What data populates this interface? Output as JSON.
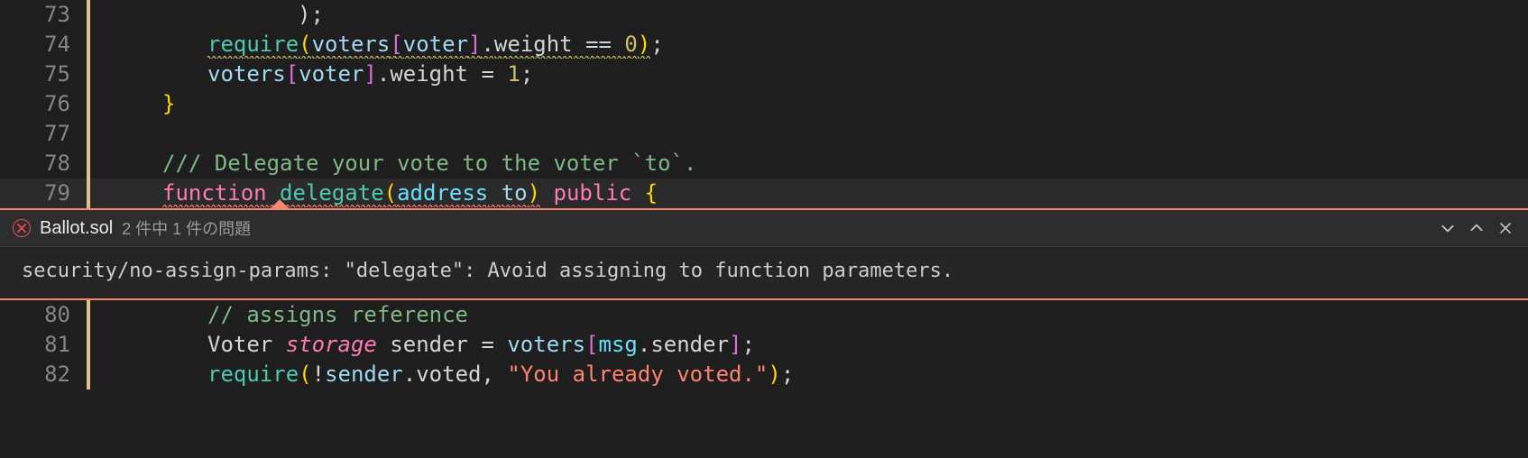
{
  "editor": {
    "lines": [
      {
        "num": "73",
        "indent": 4,
        "tokens": [
          {
            "t": ");",
            "c": "tok-op"
          }
        ]
      },
      {
        "num": "74",
        "indent": 2,
        "tokens": [
          {
            "t": "require",
            "c": "tok-func squiggle-warn"
          },
          {
            "t": "(",
            "c": "tok-paren squiggle-warn"
          },
          {
            "t": "voters",
            "c": "tok-ident squiggle-warn"
          },
          {
            "t": "[",
            "c": "tok-bracket squiggle-warn"
          },
          {
            "t": "voter",
            "c": "tok-ident squiggle-warn"
          },
          {
            "t": "]",
            "c": "tok-bracket squiggle-warn"
          },
          {
            "t": ".",
            "c": "tok-op squiggle-warn"
          },
          {
            "t": "weight",
            "c": "tok-prop squiggle-warn"
          },
          {
            "t": " == ",
            "c": "tok-op squiggle-warn"
          },
          {
            "t": "0",
            "c": "tok-num squiggle-warn"
          },
          {
            "t": ")",
            "c": "tok-paren squiggle-warn"
          },
          {
            "t": ";",
            "c": "tok-op"
          }
        ]
      },
      {
        "num": "75",
        "indent": 2,
        "tokens": [
          {
            "t": "voters",
            "c": "tok-ident"
          },
          {
            "t": "[",
            "c": "tok-bracket"
          },
          {
            "t": "voter",
            "c": "tok-ident"
          },
          {
            "t": "]",
            "c": "tok-bracket"
          },
          {
            "t": ".",
            "c": "tok-op"
          },
          {
            "t": "weight",
            "c": "tok-prop"
          },
          {
            "t": " = ",
            "c": "tok-op"
          },
          {
            "t": "1",
            "c": "tok-num"
          },
          {
            "t": ";",
            "c": "tok-op"
          }
        ]
      },
      {
        "num": "76",
        "indent": 1,
        "tokens": [
          {
            "t": "}",
            "c": "tok-brace"
          }
        ]
      },
      {
        "num": "77",
        "indent": 0,
        "tokens": []
      },
      {
        "num": "78",
        "indent": 1,
        "tokens": [
          {
            "t": "/// Delegate your vote to the voter `to`.",
            "c": "tok-doccomment"
          }
        ]
      },
      {
        "num": "79",
        "indent": 1,
        "active": true,
        "tokens": [
          {
            "t": "function",
            "c": "tok-keyword squiggle-err"
          },
          {
            "t": " ",
            "c": "squiggle-err"
          },
          {
            "t": "delegate",
            "c": "tok-func squiggle-err"
          },
          {
            "t": "(",
            "c": "tok-paren squiggle-err"
          },
          {
            "t": "address",
            "c": "tok-type squiggle-err"
          },
          {
            "t": " ",
            "c": "squiggle-err"
          },
          {
            "t": "to",
            "c": "tok-ident squiggle-err"
          },
          {
            "t": ")",
            "c": "tok-paren squiggle-err"
          },
          {
            "t": " ",
            "c": ""
          },
          {
            "t": "public",
            "c": "tok-keyword"
          },
          {
            "t": " ",
            "c": ""
          },
          {
            "t": "{",
            "c": "tok-brace"
          }
        ]
      }
    ],
    "linesAfter": [
      {
        "num": "80",
        "indent": 2,
        "tokens": [
          {
            "t": "// assigns reference",
            "c": "tok-doccomment"
          }
        ]
      },
      {
        "num": "81",
        "indent": 2,
        "tokens": [
          {
            "t": "Voter ",
            "c": "tok-prop"
          },
          {
            "t": "storage",
            "c": "tok-keyword2"
          },
          {
            "t": " sender = ",
            "c": "tok-op"
          },
          {
            "t": "voters",
            "c": "tok-ident"
          },
          {
            "t": "[",
            "c": "tok-bracket"
          },
          {
            "t": "msg",
            "c": "tok-builtin"
          },
          {
            "t": ".",
            "c": "tok-op"
          },
          {
            "t": "sender",
            "c": "tok-prop"
          },
          {
            "t": "]",
            "c": "tok-bracket"
          },
          {
            "t": ";",
            "c": "tok-op"
          }
        ]
      },
      {
        "num": "82",
        "indent": 2,
        "tokens": [
          {
            "t": "require",
            "c": "tok-func"
          },
          {
            "t": "(",
            "c": "tok-paren"
          },
          {
            "t": "!",
            "c": "tok-op"
          },
          {
            "t": "sender",
            "c": "tok-ident"
          },
          {
            "t": ".",
            "c": "tok-op"
          },
          {
            "t": "voted",
            "c": "tok-prop"
          },
          {
            "t": ", ",
            "c": "tok-op"
          },
          {
            "t": "\"You already voted.\"",
            "c": "tok-string"
          },
          {
            "t": ")",
            "c": "tok-paren"
          },
          {
            "t": ";",
            "c": "tok-op"
          }
        ]
      }
    ]
  },
  "peek": {
    "filename": "Ballot.sol",
    "count_text": "2 件中 1 件の問題",
    "message": "security/no-assign-params: \"delegate\": Avoid assigning to function parameters."
  }
}
